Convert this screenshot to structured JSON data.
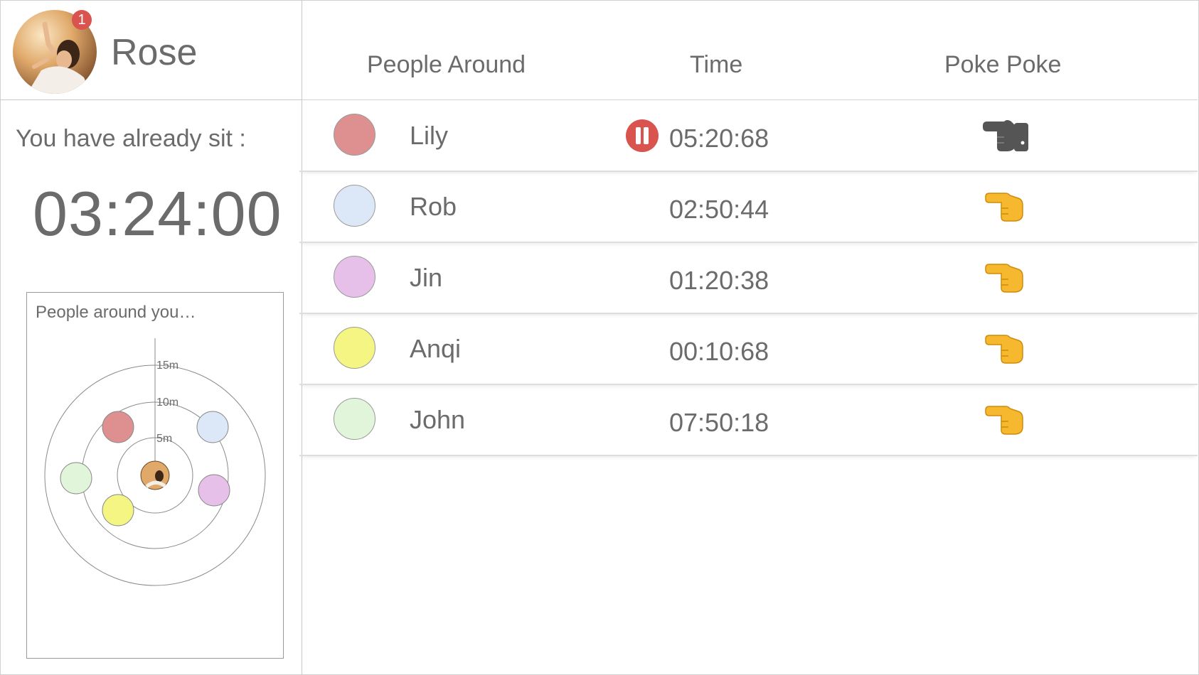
{
  "profile": {
    "name": "Rose",
    "notification_count": "1",
    "avatar_icon": "user-photo-icon"
  },
  "status": {
    "label": "You have already sit :",
    "timer": "03:24:00"
  },
  "radar": {
    "title": "People around you…",
    "ring_labels": [
      "15m",
      "10m",
      "5m"
    ]
  },
  "table": {
    "headers": {
      "people": "People Around",
      "time": "Time",
      "poke": "Poke Poke"
    },
    "rows": [
      {
        "name": "Lily",
        "time": "05:20:68",
        "color": "#de8f8f",
        "state": "paused",
        "poke_icon": "pointing-hand-icon-inactive"
      },
      {
        "name": "Rob",
        "time": "02:50:44",
        "color": "#dce8f7",
        "state": "active",
        "poke_icon": "pointing-hand-icon"
      },
      {
        "name": "Jin",
        "time": "01:20:38",
        "color": "#e6c0e9",
        "state": "active",
        "poke_icon": "pointing-hand-icon"
      },
      {
        "name": "Anqi",
        "time": "00:10:68",
        "color": "#f5f584",
        "state": "active",
        "poke_icon": "pointing-hand-icon"
      },
      {
        "name": "John",
        "time": "07:50:18",
        "color": "#e1f5da",
        "state": "active",
        "poke_icon": "pointing-hand-icon"
      }
    ]
  },
  "colors": {
    "accent_red": "#d9534f",
    "text_gray": "#6b6b6b",
    "poke_yellow": "#f5b82e",
    "poke_gray": "#555555"
  }
}
